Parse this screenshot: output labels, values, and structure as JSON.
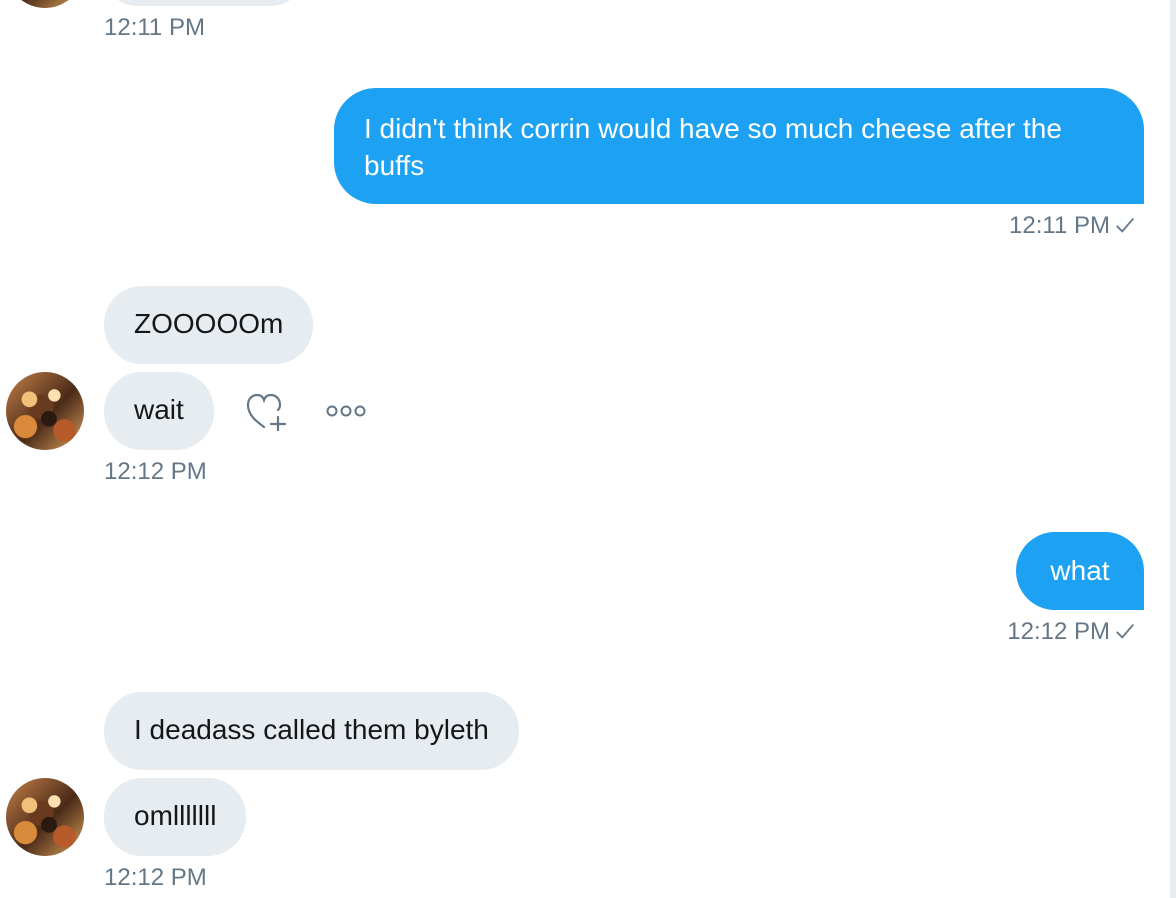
{
  "colors": {
    "outgoing": "#1da1f2",
    "incoming": "#e6ecf0",
    "timestamp": "#657786"
  },
  "messages": [
    {
      "id": "m0",
      "direction": "in",
      "timestamp": "12:11 PM"
    },
    {
      "id": "m1",
      "direction": "out",
      "text": "I didn't think corrin would have so much cheese after the buffs",
      "timestamp": "12:11 PM",
      "read_icon": "checkmark-icon"
    },
    {
      "id": "m2",
      "direction": "in",
      "texts": [
        "ZOOOOOm",
        "wait"
      ],
      "timestamp": "12:12 PM",
      "actions": [
        "add-reaction-icon",
        "more-options-icon"
      ]
    },
    {
      "id": "m3",
      "direction": "out",
      "text": "what",
      "timestamp": "12:12 PM",
      "read_icon": "checkmark-icon"
    },
    {
      "id": "m4",
      "direction": "in",
      "texts": [
        "I deadass called them byleth",
        "omlllllll"
      ],
      "timestamp": "12:12 PM"
    }
  ]
}
